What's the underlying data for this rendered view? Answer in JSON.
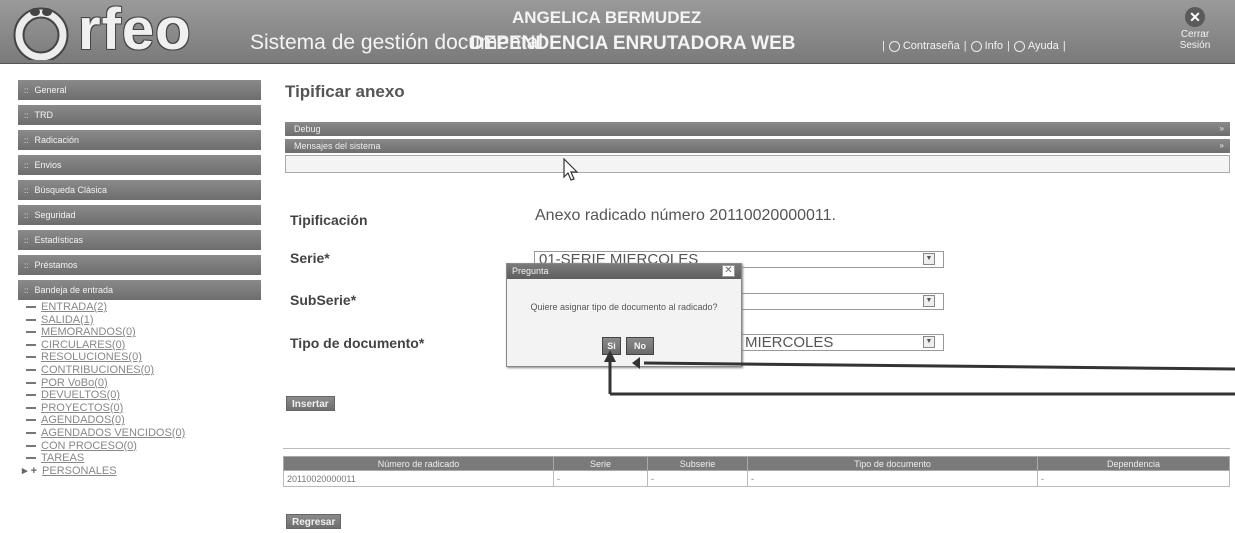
{
  "header": {
    "logo_text": "rfeo",
    "system_title": "Sistema de gestión documental",
    "user_name": "ANGELICA BERMUDEZ",
    "dependency": "DEPENDENCIA ENRUTADORA WEB",
    "links": [
      "Contraseña",
      "Info",
      "Ayuda"
    ],
    "close_label_1": "Cerrar",
    "close_label_2": "Sesión",
    "close_icon": "close-icon"
  },
  "sidebar": {
    "items": [
      "General",
      "TRD",
      "Radicación",
      "Envios",
      "Búsqueda Clásica",
      "Seguridad",
      "Estadísticas",
      "Préstamos",
      "Bandeja de entrada"
    ],
    "inbox": [
      "ENTRADA(2)",
      "SALIDA(1)",
      "MEMORANDOS(0)",
      "CIRCULARES(0)",
      "RESOLUCIONES(0)",
      "CONTRIBUCIONES(0)",
      "POR VoBo(0)",
      "DEVUELTOS(0)",
      "PROYECTOS(0)",
      "AGENDADOS(0)",
      "AGENDADOS VENCIDOS(0)",
      "CON PROCESO(0)",
      "TAREAS",
      "PERSONALES"
    ]
  },
  "main": {
    "title": "Tipificar anexo",
    "debug_label": "Debug",
    "messages_label": "Mensajes del sistema",
    "tipificacion_label": "Tipificación",
    "tipificacion_value": "Anexo radicado número 20110020000011.",
    "serie_label": "Serie*",
    "serie_value": "01-SERIE MIERCOLES",
    "subserie_label": "SubSerie*",
    "subserie_value": "",
    "tipo_label": "Tipo de documento*",
    "tipo_value": "MIERCOLES",
    "insert_button": "Insertar",
    "back_button": "Regresar"
  },
  "table": {
    "headers": [
      "Número de radicado",
      "Serie",
      "Subserie",
      "Tipo de documento",
      "Dependencia"
    ],
    "rows": [
      [
        "20110020000011",
        "-",
        "-",
        "-",
        "-"
      ]
    ]
  },
  "dialog": {
    "title": "Pregunta",
    "message": "Quiere asignar tipo de documento al radicado?",
    "yes": "Si",
    "no": "No"
  }
}
